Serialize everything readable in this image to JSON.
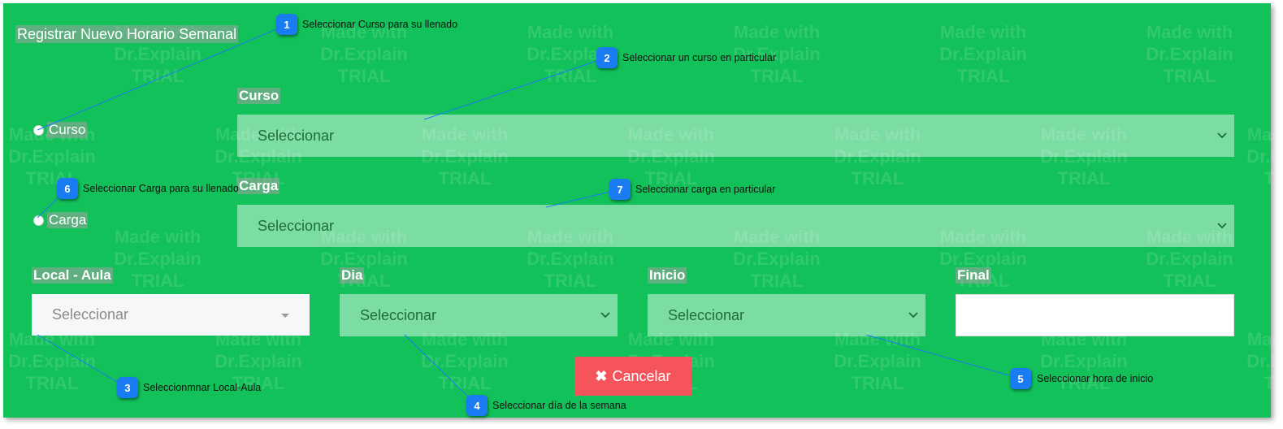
{
  "title": "Registrar Nuevo Horario Semanal",
  "watermark": "Made with Dr.Explain TRIAL",
  "radios": {
    "curso": "Curso",
    "carga": "Carga"
  },
  "fields": {
    "curso": {
      "label": "Curso",
      "value": "Seleccionar"
    },
    "carga": {
      "label": "Carga",
      "value": "Seleccionar"
    },
    "local": {
      "label": "Local - Aula",
      "value": "Seleccionar"
    },
    "dia": {
      "label": "Dia",
      "value": "Seleccionar"
    },
    "inicio": {
      "label": "Inicio",
      "value": "Seleccionar"
    },
    "final": {
      "label": "Final",
      "value": ""
    }
  },
  "buttons": {
    "cancel": "Cancelar",
    "cancel_icon": "times-icon"
  },
  "callouts": [
    {
      "num": "1",
      "text": "Seleccionar Curso para su llenado"
    },
    {
      "num": "2",
      "text": "Seleccionar un curso en particular"
    },
    {
      "num": "3",
      "text": "Seleccionmnar Local-Aula"
    },
    {
      "num": "4",
      "text": "Seleccionar día de la semana"
    },
    {
      "num": "5",
      "text": "Seleccionar hora de inicio"
    },
    {
      "num": "6",
      "text": "Seleccionar Carga para su llenado"
    },
    {
      "num": "7",
      "text": "Seleccionar carga en particular"
    }
  ],
  "colors": {
    "panel": "#12c159",
    "badge": "#1a7cf2",
    "cancel": "#f5545a"
  }
}
